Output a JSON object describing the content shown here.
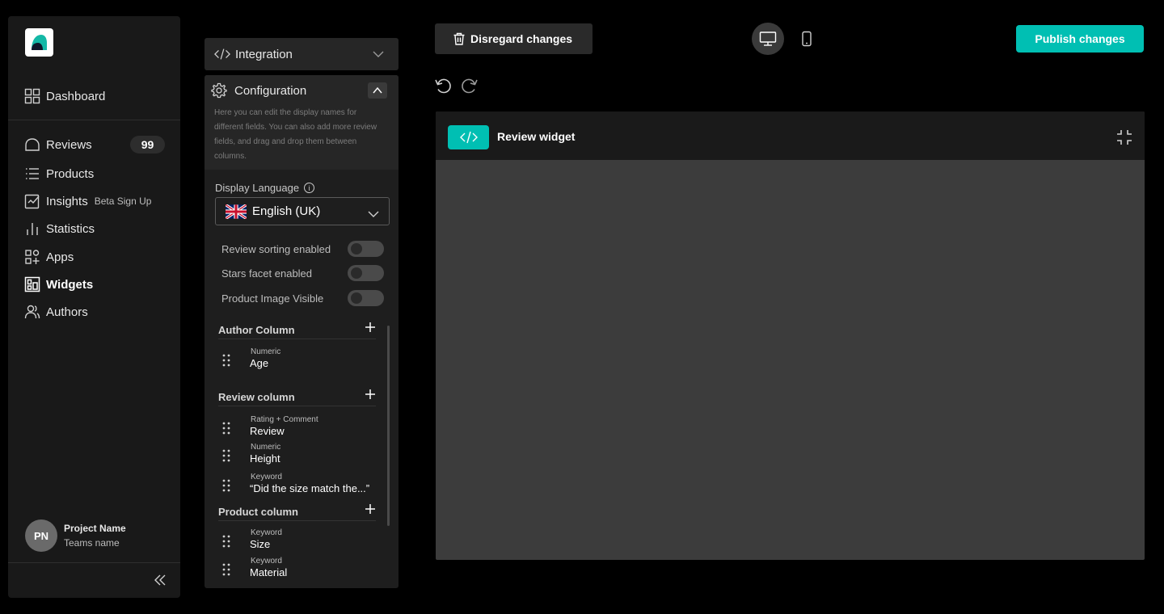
{
  "sidebar": {
    "nav": [
      {
        "label": "Dashboard",
        "icon": "dashboard-grid-icon"
      },
      {
        "label": "Reviews",
        "icon": "reviews-cloud-icon",
        "badge": "99"
      },
      {
        "label": "Products",
        "icon": "list-icon"
      },
      {
        "label": "Insights",
        "icon": "insights-icon",
        "tag": "Beta Sign Up"
      },
      {
        "label": "Statistics",
        "icon": "bar-chart-icon"
      },
      {
        "label": "Apps",
        "icon": "apps-icon"
      },
      {
        "label": "Widgets",
        "icon": "widgets-icon",
        "active": true
      },
      {
        "label": "Authors",
        "icon": "users-icon"
      }
    ],
    "project": {
      "initials": "PN",
      "name": "Project Name",
      "team": "Teams name"
    }
  },
  "panel": {
    "integration_label": "Integration",
    "configuration_label": "Configuration",
    "configuration_desc": "Here you can edit the display names for different fields. You can also add more review fields, and drag and drop them between columns.",
    "display_language_label": "Display Language",
    "display_language_value": "English (UK)",
    "toggles": [
      {
        "label": "Review sorting enabled",
        "on": false
      },
      {
        "label": "Stars facet enabled",
        "on": false
      },
      {
        "label": "Product Image Visible",
        "on": false
      }
    ],
    "columns": [
      {
        "title": "Author Column",
        "fields": [
          {
            "type": "Numeric",
            "value": "Age"
          }
        ]
      },
      {
        "title": "Review column",
        "fields": [
          {
            "type": "Rating + Comment",
            "value": "Review"
          },
          {
            "type": "Numeric",
            "value": "Height"
          },
          {
            "type": "Keyword",
            "value": "“Did the size match the...”"
          }
        ]
      },
      {
        "title": "Product column",
        "fields": [
          {
            "type": "Keyword",
            "value": "Size"
          },
          {
            "type": "Keyword",
            "value": "Material"
          }
        ]
      }
    ]
  },
  "toolbar": {
    "disregard_label": "Disregard changes",
    "publish_label": "Publish changes",
    "publish_color": "#00bfb3"
  },
  "widget": {
    "title": "Review widget"
  }
}
